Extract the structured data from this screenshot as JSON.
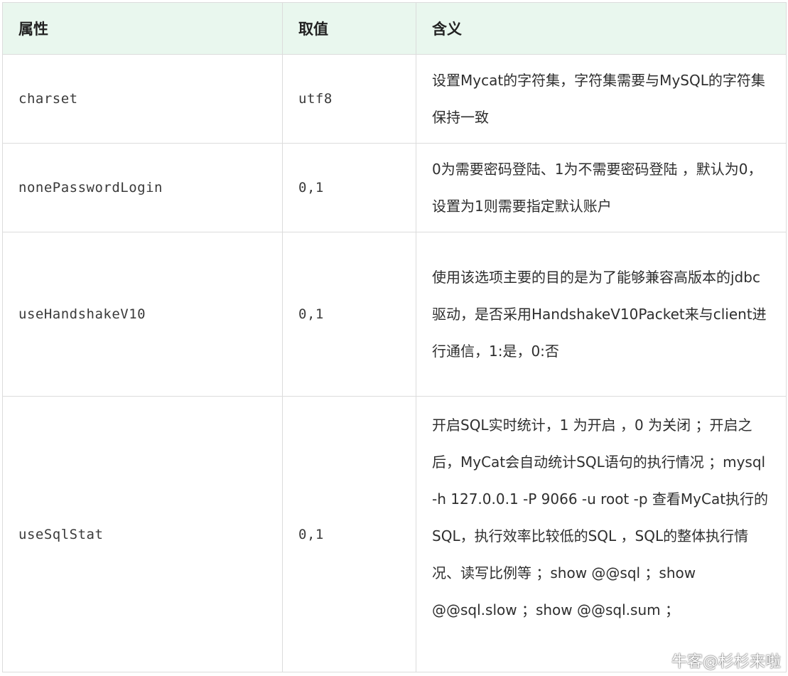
{
  "table": {
    "headers": [
      "属性",
      "取值",
      "含义"
    ],
    "rows": [
      {
        "attribute": "charset",
        "value": "utf8",
        "meaning": "设置Mycat的字符集，字符集需要与MySQL的字符集保持一致"
      },
      {
        "attribute": "nonePasswordLogin",
        "value": "0,1",
        "meaning": "0为需要密码登陆、1为不需要密码登陆 ，默认为0，设置为1则需要指定默认账户"
      },
      {
        "attribute": "useHandshakeV10",
        "value": "0,1",
        "meaning": "使用该选项主要的目的是为了能够兼容高版本的jdbc驱动，是否采用HandshakeV10Packet来与client进行通信，1:是，0:否"
      },
      {
        "attribute": "useSqlStat",
        "value": "0,1",
        "meaning": "开启SQL实时统计，1 为开启 ，0 为关闭 ；开启之后，MyCat会自动统计SQL语句的执行情况 ；mysql -h 127.0.0.1 -P 9066 -u root -p 查看MyCat执行的SQL，执行效率比较低的SQL ，SQL的整体执行情况、读写比例等 ；show @@sql ；show @@sql.slow ；show @@sql.sum ；"
      }
    ]
  },
  "watermark": {
    "text": "牛客@杉杉来啦",
    "icon": "niuke-logo-icon"
  }
}
